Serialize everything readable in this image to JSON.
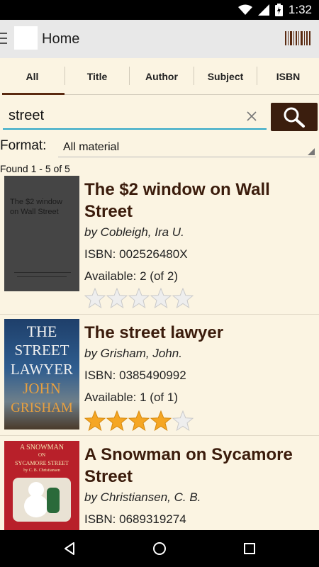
{
  "status_bar": {
    "time": "1:32",
    "icons": [
      "wifi-icon",
      "signal-icon",
      "battery-icon"
    ]
  },
  "app_bar": {
    "title": "Home",
    "menu_icon": "hamburger-icon",
    "action_icon": "barcode-icon"
  },
  "tabs": [
    {
      "label": "All",
      "selected": true
    },
    {
      "label": "Title",
      "selected": false
    },
    {
      "label": "Author",
      "selected": false
    },
    {
      "label": "Subject",
      "selected": false
    },
    {
      "label": "ISBN",
      "selected": false
    }
  ],
  "search": {
    "value": "street",
    "clear_icon": "close-icon",
    "button_icon": "search-icon"
  },
  "format": {
    "label": "Format:",
    "value": "All material"
  },
  "results_summary": "Found 1 - 5 of 5",
  "results": [
    {
      "title": "The $2 window on Wall Street",
      "author": "by Cobleigh, Ira U.",
      "isbn": "ISBN: 002526480X",
      "availability": "Available: 2 (of 2)",
      "rating": 0,
      "cover": {
        "lines": [
          "The $2 window",
          "on Wall Street"
        ]
      }
    },
    {
      "title": "The street lawyer",
      "author": "by Grisham, John.",
      "isbn": "ISBN: 0385490992",
      "availability": "Available: 1 (of 1)",
      "rating": 4,
      "cover": {
        "lines": [
          "THE",
          "STREET",
          "LAWYER",
          "JOHN",
          "GRISHAM"
        ]
      }
    },
    {
      "title": "A Snowman on Sycamore Street",
      "author": "by Christiansen, C. B.",
      "isbn": "ISBN: 0689319274",
      "availability": "",
      "rating": null,
      "cover": {
        "lines": [
          "A SNOWMAN",
          "ON",
          "SYCAMORE STREET",
          "by C. B. Christiansen"
        ]
      }
    }
  ],
  "colors": {
    "accent": "#3b1e0e",
    "title": "#3b1c0c",
    "background": "#fbf4e2",
    "search_underline": "#2fa7c7"
  },
  "nav_bar": {
    "icons": [
      "back-icon",
      "home-icon",
      "recents-icon"
    ]
  }
}
